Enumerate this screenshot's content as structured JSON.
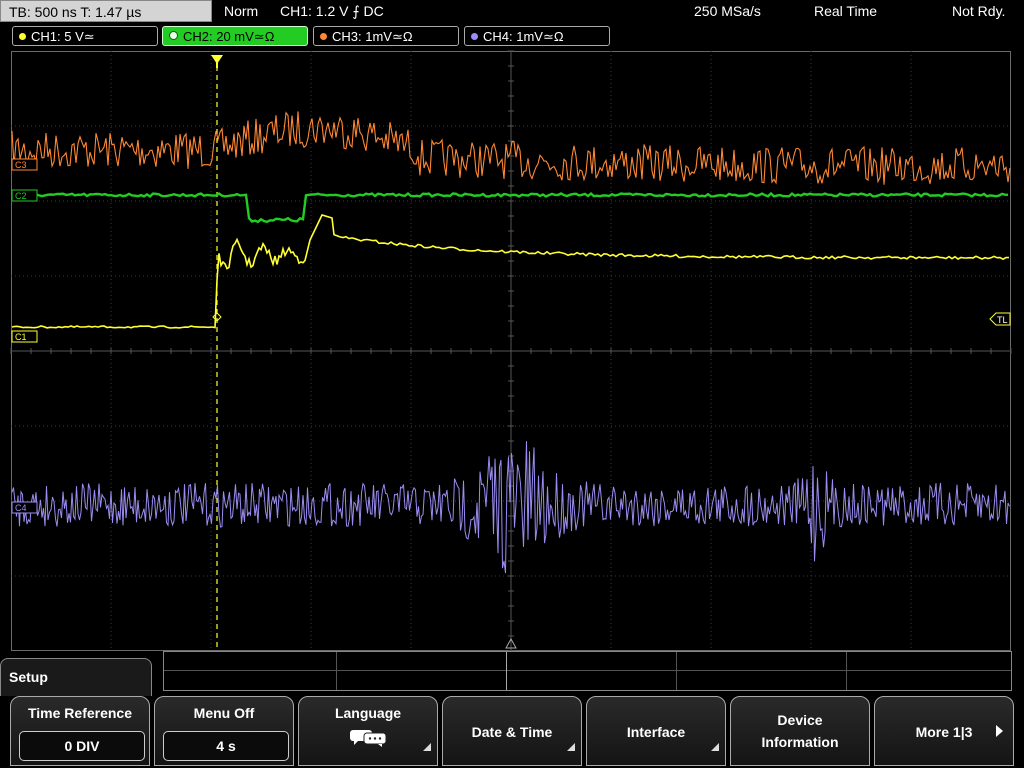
{
  "status": {
    "timebase": "TB: 500 ns   T: 1.47 µs",
    "mode": "Norm",
    "trigger": "CH1: 1.2 V ⨍ DC",
    "sample_rate": "250 MSa/s",
    "acq": "Real Time",
    "state": "Not Rdy."
  },
  "channels": [
    {
      "label": "CH1: 5 V≃",
      "color": "#ffff33"
    },
    {
      "label": "CH2: 20 mV≃Ω",
      "color": "#22cc22"
    },
    {
      "label": "CH3: 1mV≃Ω",
      "color": "#ff8833"
    },
    {
      "label": "CH4: 1mV≃Ω",
      "color": "#9a8cf0"
    }
  ],
  "markers": {
    "c1": "C1",
    "c2": "C2",
    "c3": "C3",
    "c4": "C4",
    "tl": "TL"
  },
  "menu": {
    "title": "Setup"
  },
  "softkeys": {
    "time_reference": {
      "label": "Time Reference",
      "value": "0 DIV"
    },
    "menu_off": {
      "label": "Menu Off",
      "value": "4 s"
    },
    "language": {
      "label": "Language",
      "icon": "speech-bubble-icon"
    },
    "date_time": {
      "label": "Date & Time"
    },
    "interface": {
      "label": "Interface"
    },
    "device_info": {
      "line1": "Device",
      "line2": "Information"
    },
    "more": {
      "label": "More 1|3"
    }
  }
}
